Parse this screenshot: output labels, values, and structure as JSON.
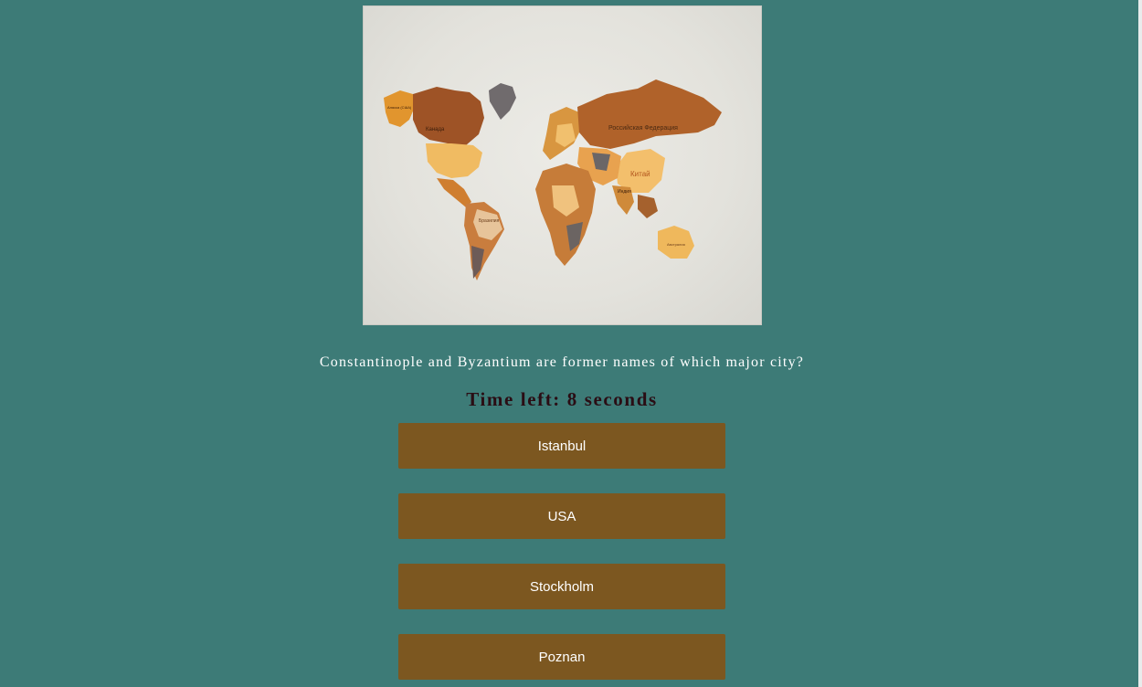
{
  "image": {
    "description_icon": "world-map-image",
    "labels": [
      "Российская Федерация",
      "Китай",
      "Канада",
      "Аляска (США)",
      "Бразилия",
      "Австралия",
      "Индия"
    ]
  },
  "question": {
    "text": "Constantinople and Byzantium are former names of which major city?"
  },
  "timer": {
    "text": "Time left: 8 seconds"
  },
  "answers": [
    {
      "label": "Istanbul"
    },
    {
      "label": "USA"
    },
    {
      "label": "Stockholm"
    },
    {
      "label": "Poznan"
    }
  ],
  "colors": {
    "background": "#3d7b77",
    "answer_button": "#7c5720",
    "timer_text": "#2a0d14"
  }
}
